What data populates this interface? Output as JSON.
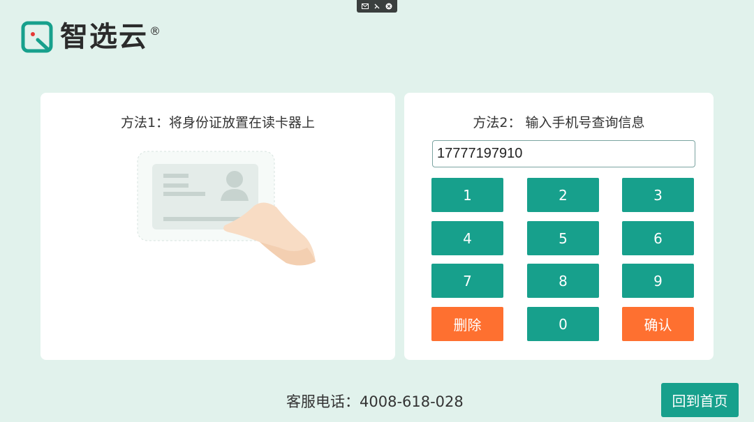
{
  "window_controls": [
    "message-icon",
    "collapse-icon",
    "close-icon"
  ],
  "logo": {
    "text": "智选云",
    "reg": "®"
  },
  "method1": {
    "title": "方法1：将身份证放置在读卡器上"
  },
  "method2": {
    "title": "方法2： 输入手机号查询信息",
    "phone_value": "17777197910",
    "keys": [
      "1",
      "2",
      "3",
      "4",
      "5",
      "6",
      "7",
      "8",
      "9",
      "删除",
      "0",
      "确认"
    ]
  },
  "footer": {
    "hotline": "客服电话：4008-618-028",
    "home_label": "回到首页"
  },
  "colors": {
    "background": "#e1f2ec",
    "primary": "#17a08c",
    "accent": "#fe7030"
  }
}
